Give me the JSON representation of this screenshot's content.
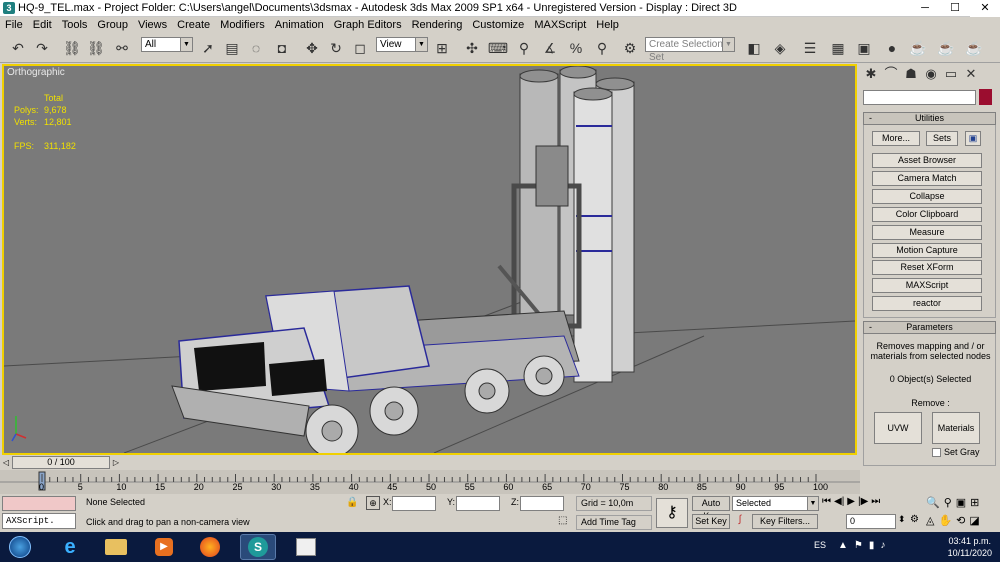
{
  "window": {
    "title": "HQ-9_TEL.max    - Project Folder: C:\\Users\\angel\\Documents\\3dsmax    - Autodesk 3ds Max  2009 SP1  x64    - Unregistered Version     - Display : Direct 3D",
    "minimize": "─",
    "maximize": "☐",
    "close": "✕"
  },
  "menu": [
    "File",
    "Edit",
    "Tools",
    "Group",
    "Views",
    "Create",
    "Modifiers",
    "Animation",
    "Graph Editors",
    "Rendering",
    "Customize",
    "MAXScript",
    "Help"
  ],
  "toolbar": {
    "selection_filter": "All",
    "ref_coord": "View",
    "named_selection_placeholder": "Create Selection Set"
  },
  "viewport": {
    "label": "Orthographic",
    "stats": {
      "header": "Total",
      "polys_label": "Polys:",
      "polys": "9,678",
      "verts_label": "Verts:",
      "verts": "12,801",
      "fps_label": "FPS:",
      "fps": "311,182"
    }
  },
  "command_panel": {
    "utilities_title": "Utilities",
    "more_button": "More...",
    "sets_button": "Sets",
    "utility_buttons": [
      "Asset Browser",
      "Camera Match",
      "Collapse",
      "Color Clipboard",
      "Measure",
      "Motion Capture",
      "Reset XForm",
      "MAXScript",
      "reactor"
    ],
    "parameters_title": "Parameters",
    "parameters_desc": "Removes mapping and / or materials from selected nodes",
    "selected_count": "0 Object(s) Selected",
    "remove_label": "Remove :",
    "uvw_button": "UVW",
    "materials_button": "Materials",
    "set_gray_label": "Set Gray"
  },
  "timeline": {
    "slider": "0 / 100",
    "ticks": [
      "0",
      "5",
      "10",
      "15",
      "20",
      "25",
      "30",
      "35",
      "40",
      "45",
      "50",
      "55",
      "60",
      "65",
      "70",
      "75",
      "80",
      "85",
      "90",
      "95",
      "100"
    ]
  },
  "status": {
    "maxscript_label": "AXScript.",
    "selection": "None Selected",
    "prompt": "Click and drag to pan a non-camera view",
    "x_label": "X:",
    "y_label": "Y:",
    "z_label": "Z:",
    "grid": "Grid = 10,0m",
    "add_time_tag": "Add Time Tag",
    "auto_key": "Auto Key",
    "auto_key_mode": "Selected",
    "set_key": "Set Key",
    "key_filters": "Key Filters...",
    "frame": "0"
  },
  "taskbar": {
    "lang": "ES",
    "time": "03:41 p.m.",
    "date": "10/11/2020"
  },
  "colors": {
    "viewport_bg": "#7a7a7a",
    "active_border": "#f0d000",
    "stats_text": "#f0e000",
    "object_color": "#9b0d2f",
    "taskbar": "#0a1a3e"
  }
}
